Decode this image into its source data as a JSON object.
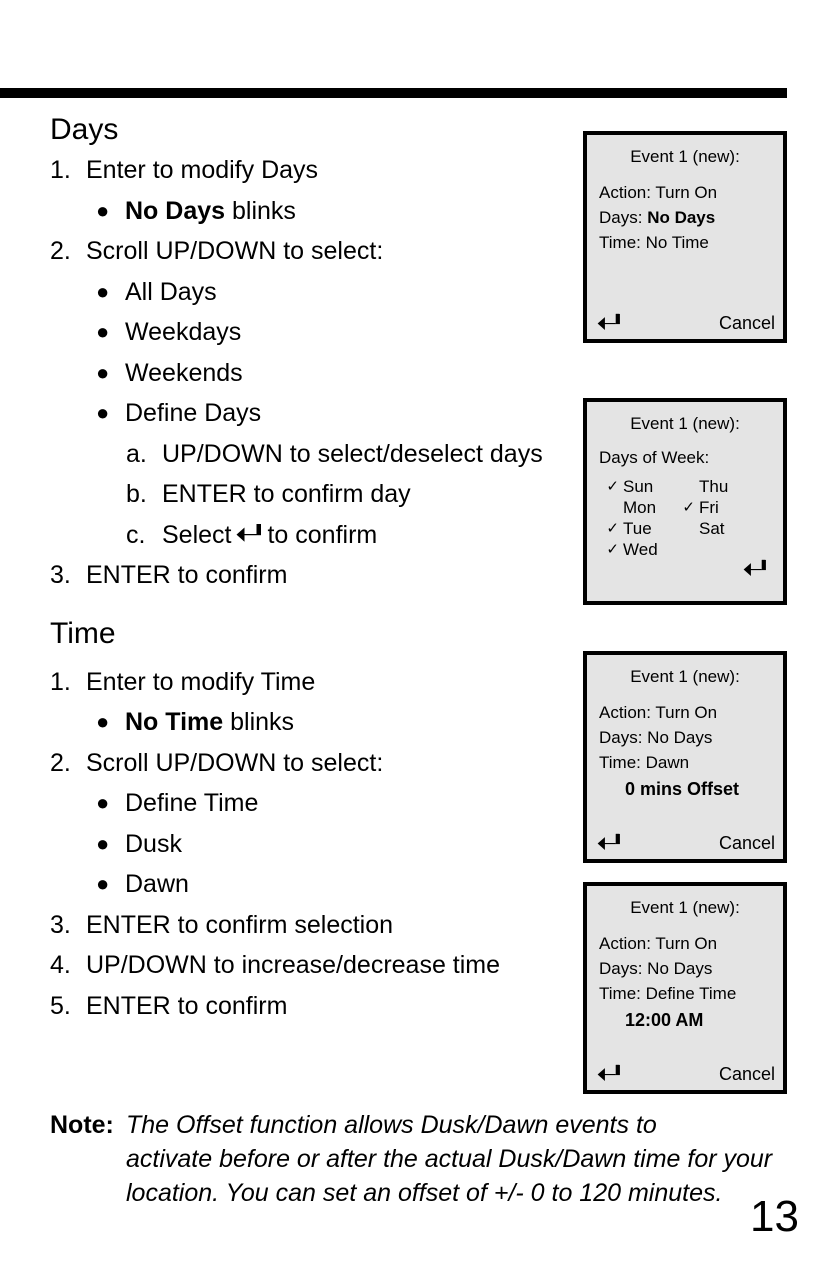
{
  "page": {
    "number": "13"
  },
  "sections": [
    {
      "heading": "Days",
      "items": [
        {
          "kind": "num",
          "marker": "1.",
          "text": "Enter to modify Days"
        },
        {
          "kind": "bullet",
          "pre": "",
          "bold": "No Days",
          "post": " blinks"
        },
        {
          "kind": "num",
          "marker": "2.",
          "text": "Scroll UP/DOWN to select:"
        },
        {
          "kind": "bullet",
          "text": "All Days"
        },
        {
          "kind": "bullet",
          "text": "Weekdays"
        },
        {
          "kind": "bullet",
          "text": "Weekends"
        },
        {
          "kind": "bullet",
          "text": "Define Days"
        },
        {
          "kind": "alpha",
          "marker": "a.",
          "text": "UP/DOWN to select/deselect days"
        },
        {
          "kind": "alpha",
          "marker": "b.",
          "text": "ENTER to confirm day"
        },
        {
          "kind": "alpha",
          "marker": "c.",
          "pre": "Select ",
          "icon": "enter-arrow-icon",
          "post": " to confirm"
        },
        {
          "kind": "num",
          "marker": "3.",
          "text": "ENTER to confirm"
        }
      ]
    },
    {
      "heading": "Time",
      "items": [
        {
          "kind": "num",
          "marker": "1.",
          "text": "Enter to modify Time"
        },
        {
          "kind": "bullet",
          "pre": "",
          "bold": "No Time",
          "post": " blinks"
        },
        {
          "kind": "num",
          "marker": "2.",
          "text": "Scroll UP/DOWN to select:"
        },
        {
          "kind": "bullet",
          "text": "Define Time"
        },
        {
          "kind": "bullet",
          "text": "Dusk"
        },
        {
          "kind": "bullet",
          "text": "Dawn"
        },
        {
          "kind": "num",
          "marker": "3.",
          "text": "ENTER to confirm selection"
        },
        {
          "kind": "num",
          "marker": "4.",
          "text": "UP/DOWN to increase/decrease time"
        },
        {
          "kind": "num",
          "marker": "5.",
          "text": "ENTER to confirm"
        }
      ]
    }
  ],
  "days_section": {
    "heading": "Days",
    "item_1_marker": "1.",
    "item_1_text": "Enter to modify Days",
    "bullet_1_bold": "No Days",
    "bullet_1_post": " blinks",
    "item_2_marker": "2.",
    "item_2_text": "Scroll UP/DOWN to select:",
    "bullet_all_days": "All Days",
    "bullet_weekdays": "Weekdays",
    "bullet_weekends": "Weekends",
    "bullet_define_days": "Define Days",
    "sub_a_marker": "a.",
    "sub_a_text": "UP/DOWN to select/deselect days",
    "sub_b_marker": "b.",
    "sub_b_text": "ENTER to confirm day",
    "sub_c_marker": "c.",
    "sub_c_pre": "Select",
    "sub_c_post": "to confirm",
    "item_3_marker": "3.",
    "item_3_text": "ENTER to confirm"
  },
  "time_section": {
    "heading": "Time",
    "item_1_marker": "1.",
    "item_1_text": "Enter to modify Time",
    "bullet_1_bold": "No Time",
    "bullet_1_post": " blinks",
    "item_2_marker": "2.",
    "item_2_text": "Scroll UP/DOWN to select:",
    "bullet_define_time": "Define Time",
    "bullet_dusk": "Dusk",
    "bullet_dawn": "Dawn",
    "item_3_marker": "3.",
    "item_3_text": "ENTER to confirm selection",
    "item_4_marker": "4.",
    "item_4_text": "UP/DOWN to increase/decrease time",
    "item_5_marker": "5.",
    "item_5_text": "ENTER to confirm"
  },
  "note": {
    "label": "Note:",
    "line1": "The Offset function allows Dusk/Dawn events to",
    "line2": "activate before or after the actual Dusk/Dawn time for your",
    "line3": "location. You can set an offset of +/- 0 to 120 minutes."
  },
  "bullet_char": "●",
  "check_char": "✓",
  "screens": [
    {
      "id": "lcd1",
      "title": "Event 1 (new):",
      "lines": [
        {
          "text": "Action: Turn On",
          "bold": false
        },
        {
          "label": "Days: ",
          "value": "No Days",
          "bold_value": true
        },
        {
          "text": "Time: No Time",
          "bold": false
        }
      ],
      "action_line": "Action: Turn On",
      "days_label": "Days: ",
      "days_value": "No Days",
      "time_line": "Time: No Time",
      "enter_icon": "enter-arrow-icon",
      "cancel": "Cancel"
    },
    {
      "id": "lcd2",
      "title": "Event 1 (new):",
      "dow_label": "Days of Week:",
      "days": [
        {
          "name": "Sun",
          "checked": true
        },
        {
          "name": "Mon",
          "checked": false
        },
        {
          "name": "Tue",
          "checked": true
        },
        {
          "name": "Wed",
          "checked": true
        },
        {
          "name": "Thu",
          "checked": false
        },
        {
          "name": "Fri",
          "checked": true
        },
        {
          "name": "Sat",
          "checked": false
        }
      ],
      "enter_icon": "enter-arrow-icon"
    },
    {
      "id": "lcd3",
      "title": "Event 1 (new):",
      "action_line": "Action: Turn On",
      "days_line": "Days: No Days",
      "time_line": "Time: Dawn",
      "emphasis": "0 mins Offset",
      "enter_icon": "enter-arrow-icon",
      "cancel": "Cancel"
    },
    {
      "id": "lcd4",
      "title": "Event 1 (new):",
      "action_line": "Action: Turn On",
      "days_line": "Days: No Days",
      "time_line": "Time: Define Time",
      "emphasis": "12:00 AM",
      "enter_icon": "enter-arrow-icon",
      "cancel": "Cancel"
    }
  ],
  "colors": {
    "ink": "#000000",
    "paper": "#ffffff",
    "lcd_background": "#e4e4e4"
  }
}
